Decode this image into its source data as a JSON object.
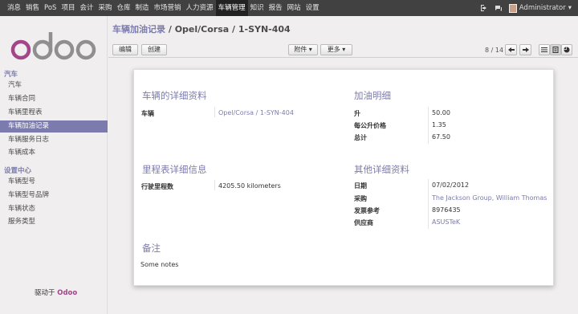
{
  "topbar": {
    "menu": [
      "消息",
      "销售",
      "PoS",
      "项目",
      "会计",
      "采购",
      "仓库",
      "制造",
      "市场营销",
      "人力资源",
      "车辆管理",
      "知识",
      "报告",
      "网站",
      "设置"
    ],
    "active_menu": "车辆管理",
    "user": "Administrator"
  },
  "sidebar": {
    "logo_text": "odoo",
    "section1": "汽车",
    "section1_items": [
      "汽车",
      "车辆合同",
      "车辆里程表",
      "车辆加油记录",
      "车辆服务日志",
      "车辆成本"
    ],
    "active_item": "车辆加油记录",
    "section2": "设置中心",
    "section2_items": [
      "车辆型号",
      "车辆型号品牌",
      "车辆状态",
      "服务类型"
    ],
    "powered_prefix": "驱动于",
    "powered_brand": "Odoo"
  },
  "header": {
    "breadcrumb_link": "车辆加油记录",
    "breadcrumb_sep": " / ",
    "breadcrumb_current": "Opel/Corsa / 1-SYN-404",
    "edit_label": "编辑",
    "create_label": "创建",
    "attach_label": "附件 ▾",
    "more_label": "更多 ▾",
    "pager": "8 / 14"
  },
  "form": {
    "vehicle_section": "车辆的详细资料",
    "vehicle_label": "车辆",
    "vehicle_value": "Opel/Corsa / 1-SYN-404",
    "fuel_section": "加油明细",
    "liter_label": "升",
    "liter_value": "50.00",
    "price_label": "每公升价格",
    "price_value": "1.35",
    "total_label": "总计",
    "total_value": "67.50",
    "odometer_section": "里程表详细信息",
    "odometer_label": "行驶里程数",
    "odometer_value": "4205.50 kilometers",
    "other_section": "其他详细资料",
    "date_label": "日期",
    "date_value": "07/02/2012",
    "purchaser_label": "采购",
    "purchaser_value": "The Jackson Group, William Thomas",
    "invoice_label": "发票参考",
    "invoice_value": "8976435",
    "supplier_label": "供应商",
    "supplier_value": "ASUSTeK",
    "notes_section": "备注",
    "notes_value": "Some notes"
  },
  "colors": {
    "accent": "#7c7bad",
    "topbar": "#414141",
    "brand": "#a24689"
  }
}
